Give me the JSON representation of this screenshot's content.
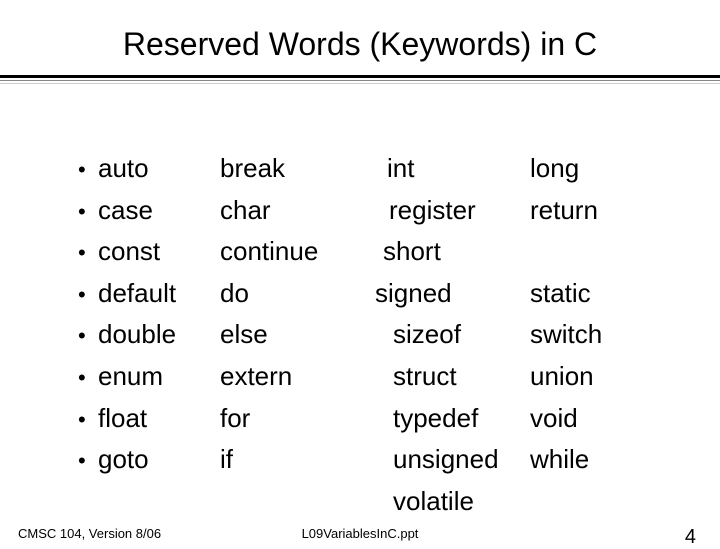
{
  "title": "Reserved Words (Keywords) in C",
  "col1": [
    "auto",
    "case",
    "const",
    "default",
    "double",
    "enum",
    "float",
    "goto"
  ],
  "col2": [
    "break",
    "char",
    "continue",
    "do",
    "else",
    "extern",
    "for",
    "if"
  ],
  "col3": [
    "int",
    "register",
    "short",
    "signed",
    "sizeof",
    "struct",
    "typedef",
    "unsigned",
    "volatile"
  ],
  "col4": [
    "long",
    "return",
    "",
    "static",
    "switch",
    "union",
    "void",
    "while"
  ],
  "footer": {
    "left": "CMSC 104, Version 8/06",
    "center": "L09VariablesInC.ppt",
    "right": "4"
  }
}
